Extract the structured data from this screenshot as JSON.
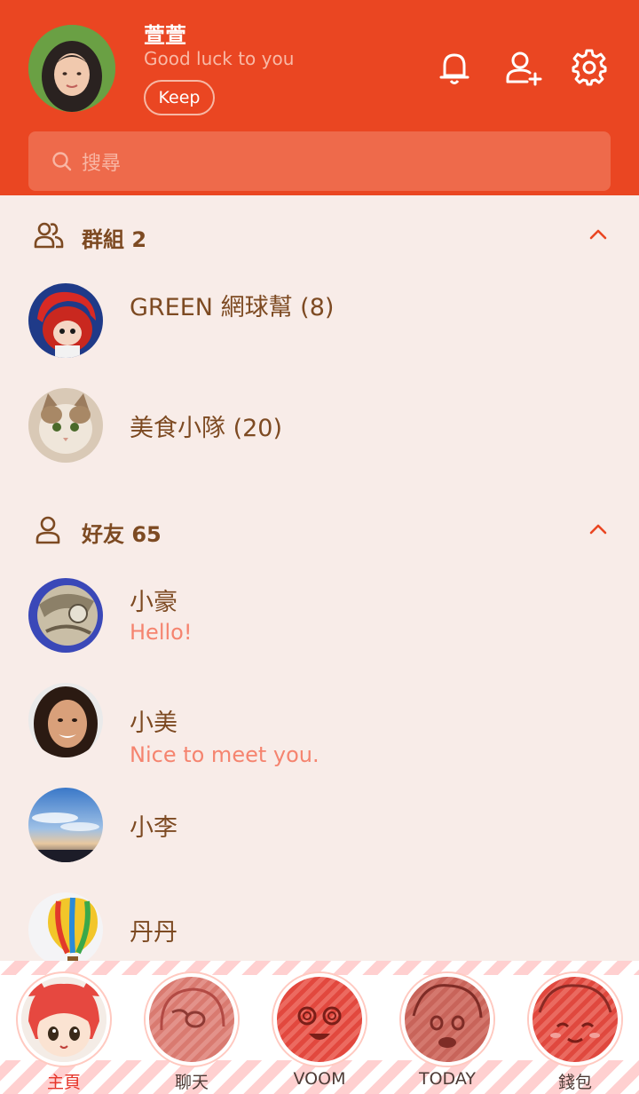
{
  "header": {
    "profile_name": "萱萱",
    "profile_status": "Good luck to you",
    "keep_label": "Keep",
    "icons": [
      "bell-icon",
      "add-friend-icon",
      "gear-icon"
    ]
  },
  "search": {
    "placeholder": "搜尋"
  },
  "groups": {
    "title": "群組 2",
    "items": [
      {
        "name": "GREEN 網球幫 (8)"
      },
      {
        "name": "美食小隊 (20)"
      }
    ]
  },
  "friends": {
    "title": "好友 65",
    "items": [
      {
        "name": "小豪",
        "message": "Hello!"
      },
      {
        "name": "小美",
        "message": "Nice to meet you."
      },
      {
        "name": "小李",
        "message": ""
      },
      {
        "name": "丹丹",
        "message": ""
      }
    ]
  },
  "tabs": [
    {
      "label": "主頁",
      "active": true
    },
    {
      "label": "聊天",
      "active": false
    },
    {
      "label": "VOOM",
      "active": false
    },
    {
      "label": "TODAY",
      "active": false
    },
    {
      "label": "錢包",
      "active": false
    }
  ],
  "colors": {
    "header_bg": "#ea4622",
    "accent": "#ea4622",
    "body_bg": "#f8ece8",
    "text_brown": "#7d4a22",
    "message_salmon": "#f5846f"
  }
}
